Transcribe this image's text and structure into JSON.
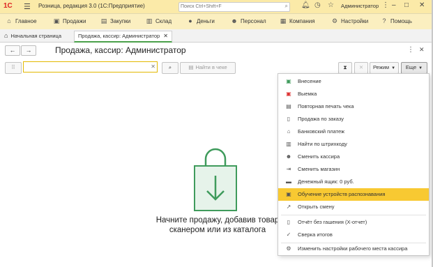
{
  "titlebar": {
    "logo": "1С",
    "title": "Розница, редакция 3.0  (1С:Предприятие)",
    "search_placeholder": "Поиск Ctrl+Shift+F",
    "user": "Администратор"
  },
  "menu": [
    {
      "label": "Главное",
      "icon": "house-icon"
    },
    {
      "label": "Продажи",
      "icon": "cart-icon"
    },
    {
      "label": "Закупки",
      "icon": "truck-icon"
    },
    {
      "label": "Склад",
      "icon": "warehouse-icon"
    },
    {
      "label": "Деньги",
      "icon": "coins-icon"
    },
    {
      "label": "Персонал",
      "icon": "person-icon"
    },
    {
      "label": "Компания",
      "icon": "building-icon"
    },
    {
      "label": "Настройки",
      "icon": "gear-icon"
    },
    {
      "label": "Помощь",
      "icon": "help-icon"
    }
  ],
  "tabs": {
    "home": "Начальная страница",
    "active": "Продажа, кассир: Администратор"
  },
  "form": {
    "title": "Продажа, кассир: Администратор",
    "search_value": "",
    "find_in_receipt": "Найти в чеке",
    "mode_button": "Режим",
    "more_button": "Еще"
  },
  "empty_state": {
    "line1": "Начните продажу, добавив товар",
    "line2": "сканером или из каталога"
  },
  "dropdown": {
    "items": [
      {
        "label": "Внесение",
        "icon": "deposit-icon"
      },
      {
        "label": "Выемка",
        "icon": "withdrawal-icon"
      },
      {
        "label": "Повторная печать чека",
        "icon": "printer-icon"
      },
      {
        "label": "Продажа по заказу",
        "icon": "order-icon"
      },
      {
        "label": "Банковский платеж",
        "icon": "bank-icon"
      },
      {
        "label": "Найти по штрихкоду",
        "icon": "barcode-icon"
      },
      {
        "label": "Сменить кассира",
        "icon": "user-icon"
      },
      {
        "label": "Сменить магазин",
        "icon": "store-icon"
      },
      {
        "label": "Денежный ящик: 0 руб.",
        "icon": "cash-drawer-icon"
      },
      {
        "label": "Обучение устройств распознавания",
        "icon": "recognition-icon"
      },
      {
        "label": "Открыть смену",
        "icon": "shift-icon"
      },
      {
        "label": "Отчёт без гашения (X-отчет)",
        "icon": "report-icon"
      },
      {
        "label": "Сверка итогов",
        "icon": "check-icon"
      },
      {
        "label": "Изменить настройки рабочего места кассира",
        "icon": "gear-icon"
      }
    ],
    "highlighted_index": 9
  },
  "colors": {
    "title_bg": "#fbeaa8",
    "menu_bg": "#fbefc0",
    "highlight": "#f8c932",
    "bag_fill": "#e6f3ea",
    "bag_stroke": "#3f9b5c"
  }
}
